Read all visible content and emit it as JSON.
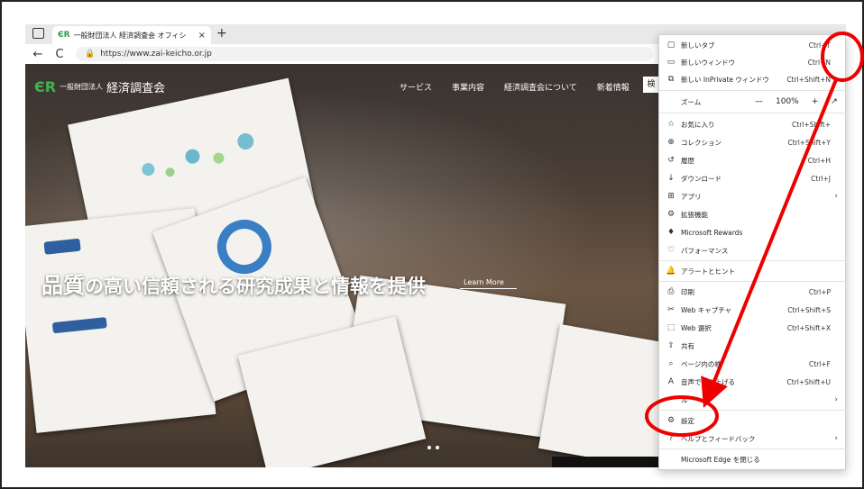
{
  "browser": {
    "tab_title": "一般財団法人 経済調査会 オフィシ",
    "tab_close": "×",
    "new_tab": "+",
    "url": "https://www.zai-keicho.or.jp",
    "nav_back": "←",
    "nav_reload": "C",
    "lock": "🔒"
  },
  "site": {
    "logo_mark": "ЄR",
    "logo_small": "一般財団法人",
    "logo_big": "経済調査会",
    "nav": [
      "サービス",
      "事業内容",
      "経済調査会について",
      "新着情報"
    ],
    "search_label": "検",
    "headline_a": "品質",
    "headline_b": "の高い信頼される研究成果と情報を提供",
    "learn_more": "Learn More"
  },
  "menu": {
    "items": [
      {
        "icon": "▢",
        "label": "新しいタブ",
        "shortcut": "Ctrl+T"
      },
      {
        "icon": "▭",
        "label": "新しいウィンドウ",
        "shortcut": "Ctrl+N"
      },
      {
        "icon": "⧉",
        "label": "新しい InPrivate ウィンドウ",
        "shortcut": "Ctrl+Shift+N"
      },
      {
        "label": "ズーム",
        "zoom_minus": "—",
        "zoom_value": "100%",
        "zoom_plus": "+",
        "expand": "↗"
      },
      {
        "icon": "☆",
        "label": "お気に入り",
        "shortcut": "Ctrl+Shift+"
      },
      {
        "icon": "⊕",
        "label": "コレクション",
        "shortcut": "Ctrl+Shift+Y"
      },
      {
        "icon": "↺",
        "label": "履歴",
        "shortcut": "Ctrl+H"
      },
      {
        "icon": "↓",
        "label": "ダウンロード",
        "shortcut": "Ctrl+J"
      },
      {
        "icon": "⊞",
        "label": "アプリ",
        "arrow": "›"
      },
      {
        "icon": "⚙",
        "label": "拡張機能"
      },
      {
        "icon": "♦",
        "label": "Microsoft Rewards"
      },
      {
        "icon": "♡",
        "label": "パフォーマンス"
      },
      {
        "icon": "🔔",
        "label": "アラートとヒント"
      },
      {
        "icon": "⎙",
        "label": "印刷",
        "shortcut": "Ctrl+P"
      },
      {
        "icon": "✂",
        "label": "Web キャプチャ",
        "shortcut": "Ctrl+Shift+S"
      },
      {
        "icon": "⬚",
        "label": "Web 選択",
        "shortcut": "Ctrl+Shift+X"
      },
      {
        "icon": "⇪",
        "label": "共有"
      },
      {
        "icon": "⌕",
        "label": "ページ内の検",
        "shortcut": "Ctrl+F"
      },
      {
        "icon": "A",
        "label": "音声で読み上げる",
        "shortcut": "Ctrl+Shift+U"
      },
      {
        "icon": "",
        "label": "ル",
        "arrow": "›"
      },
      {
        "icon": "⚙",
        "label": "設定"
      },
      {
        "icon": "?",
        "label": "ヘルプとフィードバック",
        "arrow": "›"
      },
      {
        "label": "Microsoft Edge を閉じる"
      }
    ]
  },
  "ellipsis": "···"
}
